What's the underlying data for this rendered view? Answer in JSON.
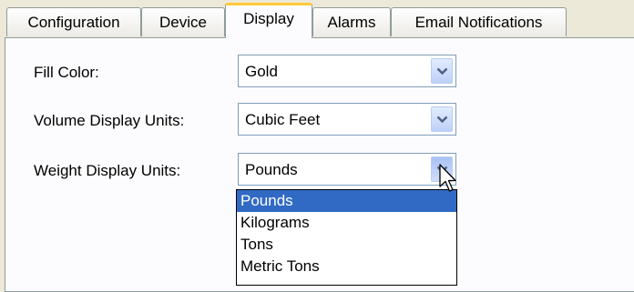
{
  "tabs": [
    {
      "label": "Configuration",
      "active": false
    },
    {
      "label": "Device",
      "active": false
    },
    {
      "label": "Display",
      "active": true
    },
    {
      "label": "Alarms",
      "active": false
    },
    {
      "label": "Email Notifications",
      "active": false
    }
  ],
  "form": {
    "fill_color": {
      "label": "Fill Color:",
      "value": "Gold"
    },
    "volume_units": {
      "label": "Volume Display Units:",
      "value": "Cubic Feet"
    },
    "weight_units": {
      "label": "Weight Display Units:",
      "value": "Pounds",
      "options": [
        "Pounds",
        "Kilograms",
        "Tons",
        "Metric Tons"
      ],
      "highlighted": "Pounds"
    }
  },
  "colors": {
    "highlight": "#316ac5",
    "active_tab_accent": "#ffc83c",
    "window_background": "#ece9d8"
  },
  "icons": [
    "chevron-down-icon",
    "mouse-pointer-icon"
  ]
}
